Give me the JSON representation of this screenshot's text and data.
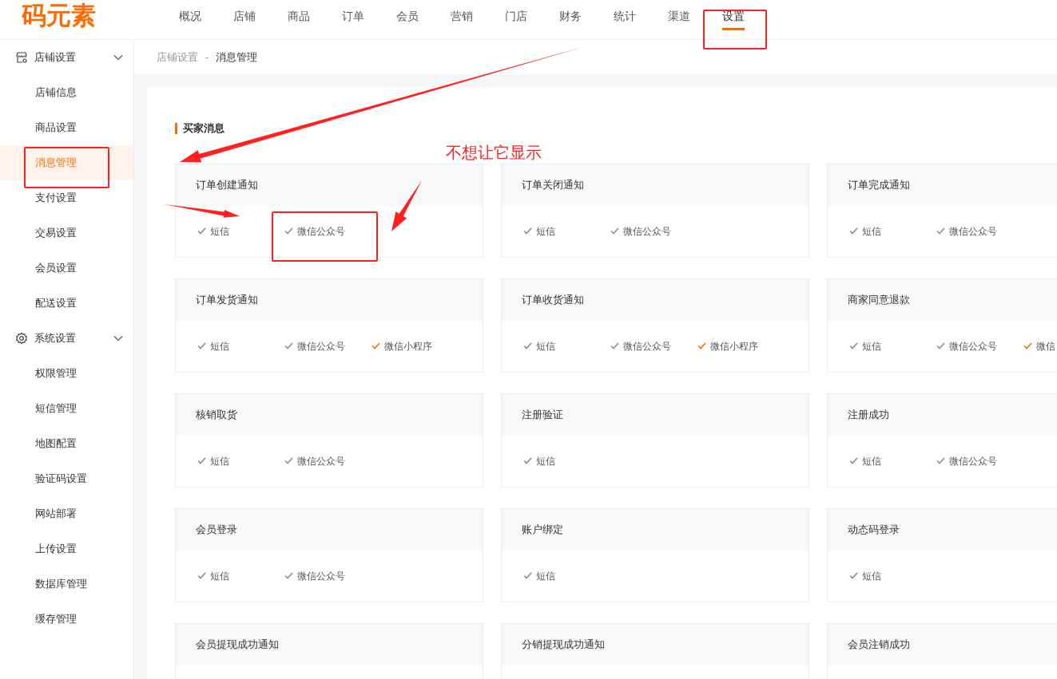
{
  "logo": "码元素",
  "nav": [
    {
      "label": "概况",
      "selected": false
    },
    {
      "label": "店铺",
      "selected": false
    },
    {
      "label": "商品",
      "selected": false
    },
    {
      "label": "订单",
      "selected": false
    },
    {
      "label": "会员",
      "selected": false
    },
    {
      "label": "营销",
      "selected": false
    },
    {
      "label": "门店",
      "selected": false
    },
    {
      "label": "财务",
      "selected": false
    },
    {
      "label": "统计",
      "selected": false
    },
    {
      "label": "渠道",
      "selected": false
    },
    {
      "label": "设置",
      "selected": true
    }
  ],
  "sidebar": [
    {
      "label": "店铺设置",
      "expanded": true,
      "children": [
        {
          "label": "店铺信息",
          "selected": false
        },
        {
          "label": "商品设置",
          "selected": false
        },
        {
          "label": "消息管理",
          "selected": true
        },
        {
          "label": "支付设置",
          "selected": false
        },
        {
          "label": "交易设置",
          "selected": false
        },
        {
          "label": "会员设置",
          "selected": false
        },
        {
          "label": "配送设置",
          "selected": false
        }
      ]
    },
    {
      "label": "系统设置",
      "expanded": true,
      "children": [
        {
          "label": "权限管理",
          "selected": false
        },
        {
          "label": "短信管理",
          "selected": false
        },
        {
          "label": "地图配置",
          "selected": false
        },
        {
          "label": "验证码设置",
          "selected": false
        },
        {
          "label": "网站部署",
          "selected": false
        },
        {
          "label": "上传设置",
          "selected": false
        },
        {
          "label": "数据库管理",
          "selected": false
        },
        {
          "label": "缓存管理",
          "selected": false
        }
      ]
    }
  ],
  "breadcrumb": {
    "items": [
      "店铺设置",
      "消息管理"
    ],
    "separator": "-"
  },
  "section_title": "买家消息",
  "cards": [
    {
      "title": "订单创建通知",
      "options": [
        {
          "label": "短信",
          "color": "#8c8c8c"
        },
        {
          "label": "微信公众号",
          "color": "#8c8c8c"
        }
      ]
    },
    {
      "title": "订单关闭通知",
      "options": [
        {
          "label": "短信",
          "color": "#8c8c8c"
        },
        {
          "label": "微信公众号",
          "color": "#8c8c8c"
        }
      ]
    },
    {
      "title": "订单完成通知",
      "options": [
        {
          "label": "短信",
          "color": "#8c8c8c"
        },
        {
          "label": "微信公众号",
          "color": "#8c8c8c"
        }
      ]
    },
    {
      "title": "订单发货通知",
      "options": [
        {
          "label": "短信",
          "color": "#8c8c8c"
        },
        {
          "label": "微信公众号",
          "color": "#8c8c8c"
        },
        {
          "label": "微信小程序",
          "color": "#ff6a00"
        }
      ]
    },
    {
      "title": "订单收货通知",
      "options": [
        {
          "label": "短信",
          "color": "#8c8c8c"
        },
        {
          "label": "微信公众号",
          "color": "#8c8c8c"
        },
        {
          "label": "微信小程序",
          "color": "#ff6a00"
        }
      ]
    },
    {
      "title": "商家同意退款",
      "options": [
        {
          "label": "短信",
          "color": "#8c8c8c"
        },
        {
          "label": "微信公众号",
          "color": "#8c8c8c"
        },
        {
          "label": "微信",
          "color": "#ff6a00"
        }
      ]
    },
    {
      "title": "核销取货",
      "options": [
        {
          "label": "短信",
          "color": "#8c8c8c"
        },
        {
          "label": "微信公众号",
          "color": "#8c8c8c"
        }
      ]
    },
    {
      "title": "注册验证",
      "options": [
        {
          "label": "短信",
          "color": "#8c8c8c"
        }
      ]
    },
    {
      "title": "注册成功",
      "options": [
        {
          "label": "短信",
          "color": "#8c8c8c"
        },
        {
          "label": "微信公众号",
          "color": "#8c8c8c"
        }
      ]
    },
    {
      "title": "会员登录",
      "options": [
        {
          "label": "短信",
          "color": "#8c8c8c"
        },
        {
          "label": "微信公众号",
          "color": "#8c8c8c"
        }
      ]
    },
    {
      "title": "账户绑定",
      "options": [
        {
          "label": "短信",
          "color": "#8c8c8c"
        }
      ]
    },
    {
      "title": "动态码登录",
      "options": [
        {
          "label": "短信",
          "color": "#8c8c8c"
        }
      ]
    },
    {
      "title": "会员提现成功通知"
    },
    {
      "title": "分销提现成功通知"
    },
    {
      "title": "会员注销成功"
    }
  ],
  "annotation": {
    "text": "不想让它显示"
  }
}
